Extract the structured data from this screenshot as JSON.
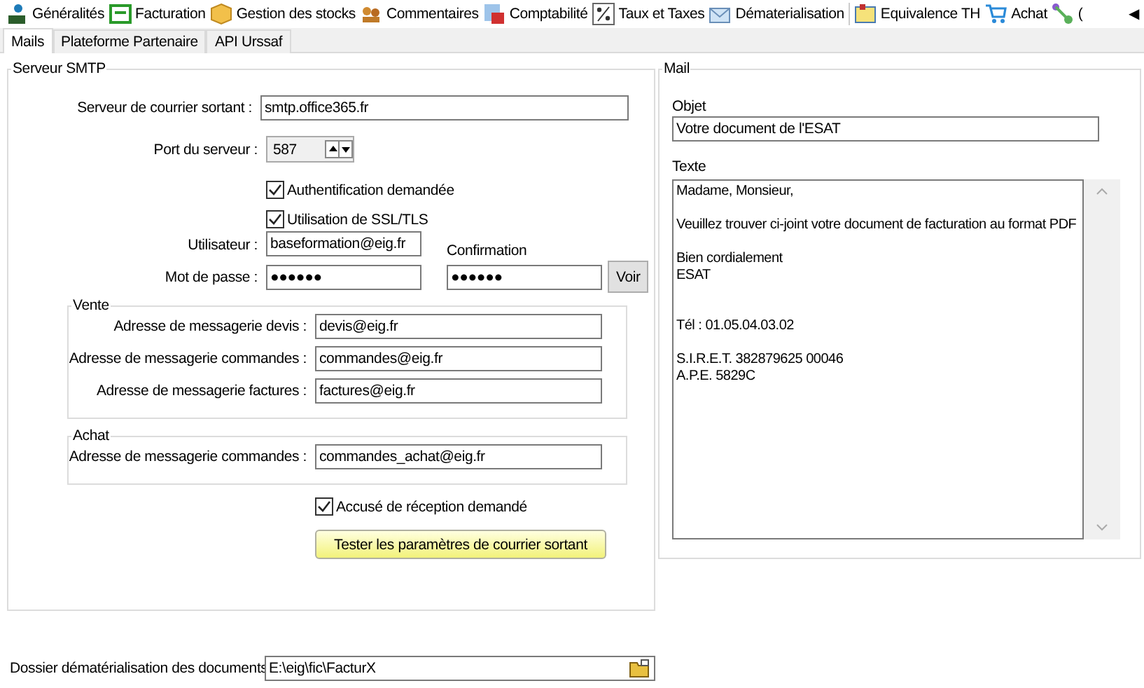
{
  "toolbar": {
    "items": [
      {
        "label": "Généralités"
      },
      {
        "label": "Facturation"
      },
      {
        "label": "Gestion des stocks"
      },
      {
        "label": "Commentaires"
      },
      {
        "label": "Comptabilité"
      },
      {
        "label": "Taux et Taxes"
      },
      {
        "label": "Dématerialisation"
      },
      {
        "label": "Equivalence TH"
      },
      {
        "label": "Achat"
      },
      {
        "label": "("
      }
    ],
    "scroll_arrow": "◀"
  },
  "tabs": [
    {
      "label": "Mails",
      "selected": true
    },
    {
      "label": "Plateforme Partenaire",
      "selected": false
    },
    {
      "label": "API Urssaf",
      "selected": false
    }
  ],
  "smtp": {
    "title": "Serveur SMTP",
    "server": {
      "label": "Serveur de courrier sortant :",
      "value": "smtp.office365.fr"
    },
    "port": {
      "label": "Port du serveur :",
      "value": "587"
    },
    "checks": [
      {
        "label": "Authentification demandée",
        "checked": true
      },
      {
        "label": "Utilisation de SSL/TLS",
        "checked": true
      }
    ],
    "user": {
      "label": "Utilisateur :",
      "value": "baseformation@eig.fr"
    },
    "password": {
      "label": "Mot de passe :",
      "value": "●●●●●●"
    },
    "confirmation": {
      "label": "Confirmation",
      "value": "●●●●●●"
    },
    "show_button": "Voir",
    "vente": {
      "title": "Vente",
      "rows": [
        {
          "label": "Adresse de messagerie devis :",
          "value": "devis@eig.fr"
        },
        {
          "label": "Adresse de messagerie commandes :",
          "value": "commandes@eig.fr"
        },
        {
          "label": "Adresse de messagerie factures :",
          "value": "factures@eig.fr"
        }
      ]
    },
    "achat": {
      "title": "Achat",
      "rows": [
        {
          "label": "Adresse de messagerie commandes :",
          "value": "commandes_achat@eig.fr"
        }
      ]
    },
    "receipt": {
      "label": "Accusé de réception demandé",
      "checked": true
    },
    "test_button": "Tester les paramètres de courrier sortant"
  },
  "mail": {
    "title": "Mail",
    "subject": {
      "label": "Objet",
      "value": "Votre document de l'ESAT"
    },
    "body": {
      "label": "Texte",
      "value": "Madame, Monsieur,\n\nVeuillez trouver ci-joint votre document de facturation au format PDF\n\nBien cordialement\nESAT\n\n\nTél : 01.05.04.03.02\n\nS.I.R.E.T. 382879625 00046\nA.P.E. 5829C"
    }
  },
  "folder": {
    "label": "Dossier dématérialisation des documents",
    "value": "E:\\eig\\fic\\FacturX"
  }
}
